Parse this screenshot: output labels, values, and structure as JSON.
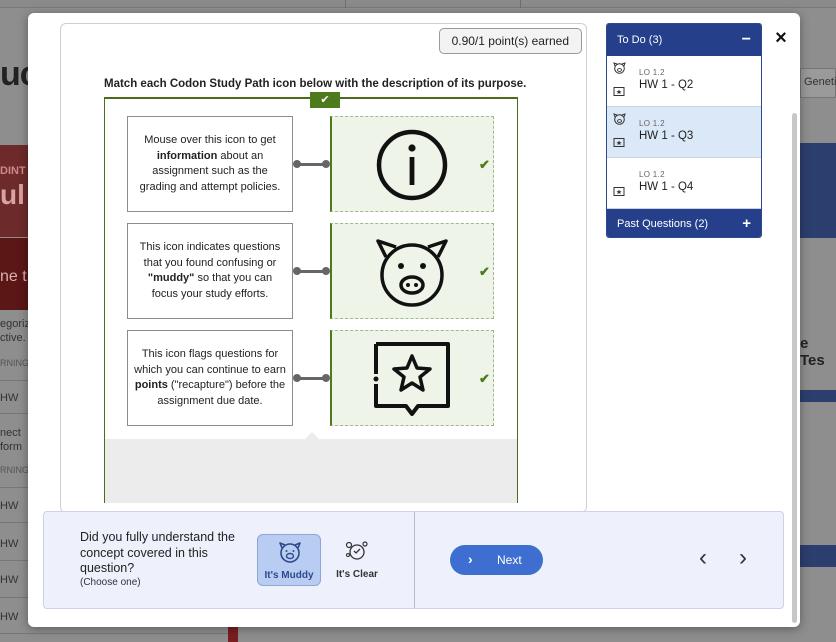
{
  "background": {
    "left_title": "uc",
    "red_label": "DINT",
    "red_big": "ul",
    "red_text": "ne t",
    "left_texts": [
      "egoriz",
      "ctive.",
      "RNING",
      "nect",
      "form",
      "RNING"
    ],
    "hw_items": [
      "HW",
      "HW",
      "HW",
      "HW",
      "HW",
      "HW"
    ],
    "right_card": "Geneti",
    "right_test": "e Tes"
  },
  "modal": {
    "close_label": "×"
  },
  "question": {
    "points_earned": "0.90/1 point(s) earned",
    "title": "Match each Codon Study Path icon below with the description of its purpose.",
    "correct_mark": "✔",
    "descriptions": [
      {
        "pre": "Mouse over this icon to get ",
        "bold": "information",
        "post": " about an assignment such as the grading and attempt policies."
      },
      {
        "pre": "This icon indicates questions that you found confusing or ",
        "bold": "\"muddy\"",
        "post": " so that you can focus your study efforts."
      },
      {
        "pre": "This icon flags questions for which you can continue to earn ",
        "bold": "points",
        "post": " (\"recapture\") before the assignment due date."
      }
    ],
    "icons": [
      {
        "icon": "info-icon",
        "check": "✔"
      },
      {
        "icon": "pig-icon",
        "check": "✔"
      },
      {
        "icon": "star-flag-icon",
        "check": "✔"
      }
    ]
  },
  "side_panel": {
    "todo_header": "To Do (3)",
    "todo_toggle": "−",
    "items": [
      {
        "lo": "LO 1.2",
        "title": "HW 1 - Q2"
      },
      {
        "lo": "LO 1.2",
        "title": "HW 1 - Q3"
      },
      {
        "lo": "LO 1.2",
        "title": "HW 1 - Q4"
      }
    ],
    "past_header": "Past Questions (2)",
    "past_toggle": "+"
  },
  "bottom_bar": {
    "question": "Did you fully understand the concept covered in this question?",
    "instruction": "(Choose one)",
    "muddy_label": "It's Muddy",
    "clear_label": "It's Clear",
    "next_label": "Next",
    "next_arrow": "›",
    "prev_arrow": "‹",
    "fwd_arrow": "›"
  },
  "colors": {
    "accent_blue": "#253f8a",
    "next_blue": "#3e6fd0",
    "correct_green": "#4d7a1c",
    "selected_bg": "#dbe8f8"
  }
}
